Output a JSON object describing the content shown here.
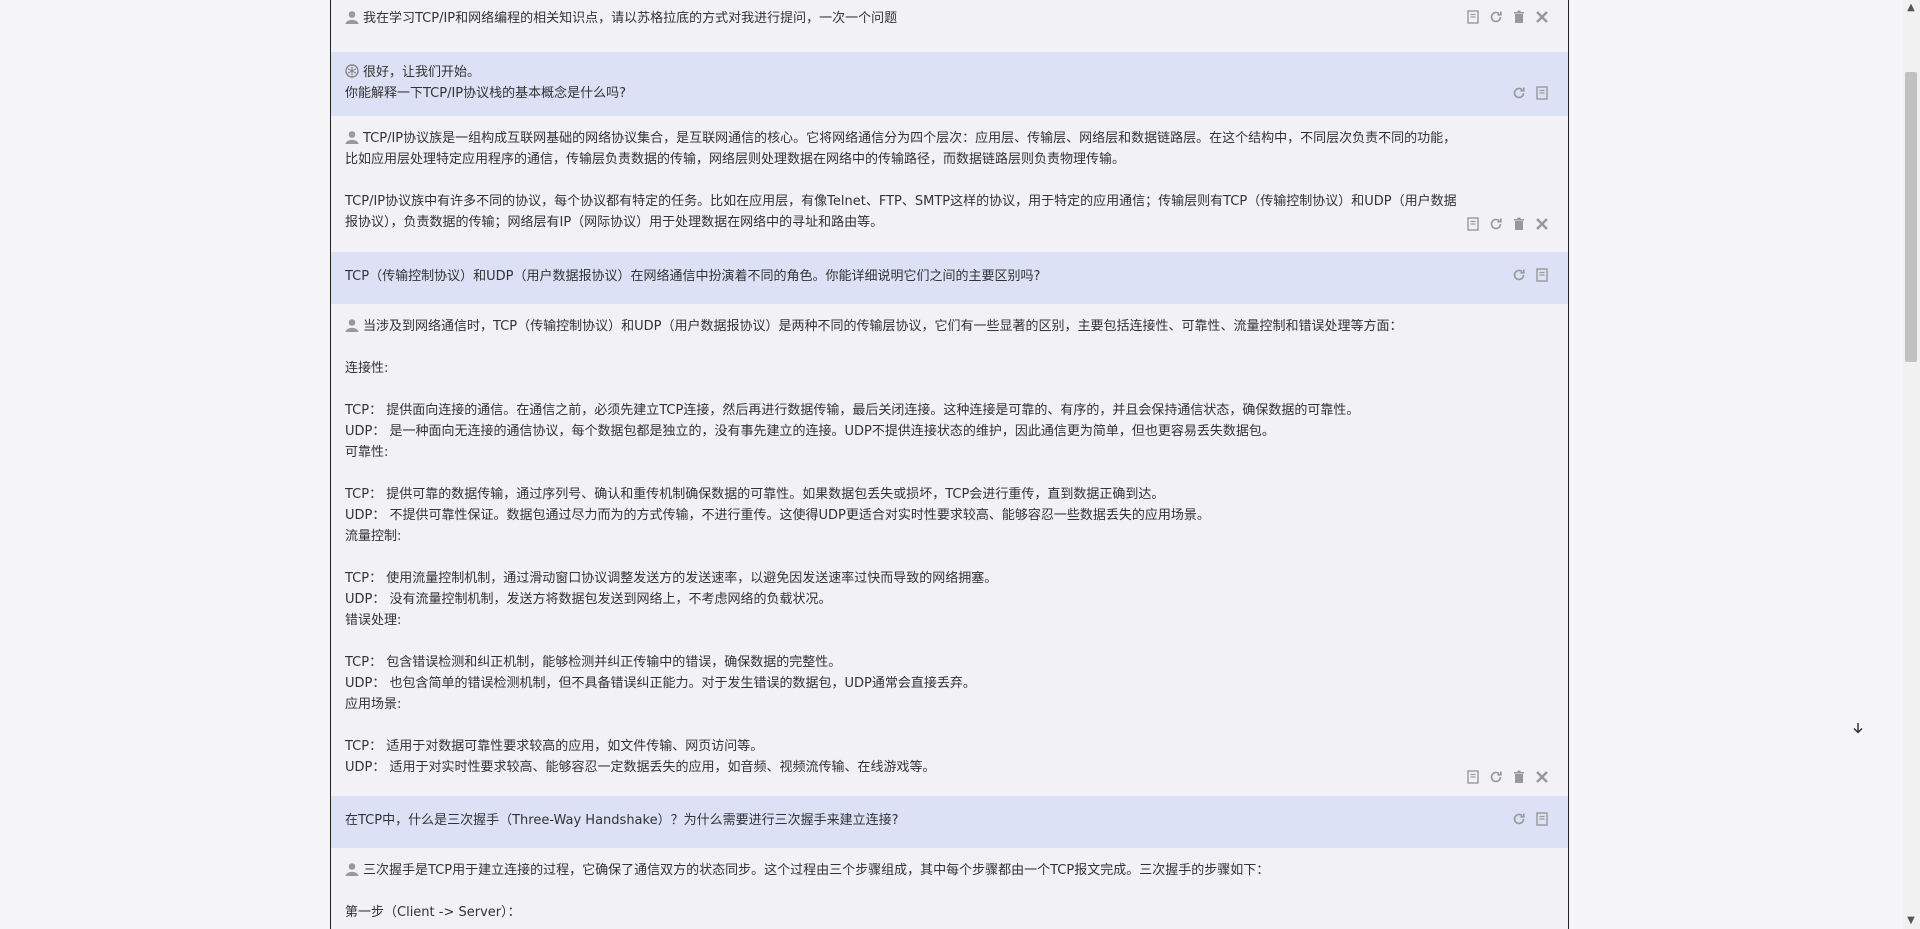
{
  "messages": [
    {
      "role": "user",
      "lines": [
        "我在学习TCP/IP和网络编程的相关知识点，请以苏格拉底的方式对我进行提问，一次一个问题"
      ]
    },
    {
      "role": "bot",
      "lines": [
        "很好，让我们开始。",
        "你能解释一下TCP/IP协议栈的基本概念是什么吗?"
      ]
    },
    {
      "role": "user",
      "lines": [
        "TCP/IP协议族是一组构成互联网基础的网络协议集合，是互联网通信的核心。它将网络通信分为四个层次：应用层、传输层、网络层和数据链路层。在这个结构中，不同层次负责不同的功能，",
        "比如应用层处理特定应用程序的通信，传输层负责数据的传输，网络层则处理数据在网络中的传输路径，而数据链路层则负责物理传输。",
        "",
        "TCP/IP协议族中有许多不同的协议，每个协议都有特定的任务。比如在应用层，有像Telnet、FTP、SMTP这样的协议，用于特定的应用通信；传输层则有TCP（传输控制协议）和UDP（用户数据",
        "报协议），负责数据的传输；网络层有IP（网际协议）用于处理数据在网络中的寻址和路由等。"
      ]
    },
    {
      "role": "bot",
      "lines": [
        "TCP（传输控制协议）和UDP（用户数据报协议）在网络通信中扮演着不同的角色。你能详细说明它们之间的主要区别吗?"
      ]
    },
    {
      "role": "user",
      "lines": [
        "当涉及到网络通信时，TCP（传输控制协议）和UDP（用户数据报协议）是两种不同的传输层协议，它们有一些显著的区别，主要包括连接性、可靠性、流量控制和错误处理等方面：",
        "",
        "连接性:",
        "",
        "TCP： 提供面向连接的通信。在通信之前，必须先建立TCP连接，然后再进行数据传输，最后关闭连接。这种连接是可靠的、有序的，并且会保持通信状态，确保数据的可靠性。",
        "UDP： 是一种面向无连接的通信协议，每个数据包都是独立的，没有事先建立的连接。UDP不提供连接状态的维护，因此通信更为简单，但也更容易丢失数据包。",
        "可靠性:",
        "",
        "TCP： 提供可靠的数据传输，通过序列号、确认和重传机制确保数据的可靠性。如果数据包丢失或损坏，TCP会进行重传，直到数据正确到达。",
        "UDP： 不提供可靠性保证。数据包通过尽力而为的方式传输，不进行重传。这使得UDP更适合对实时性要求较高、能够容忍一些数据丢失的应用场景。",
        "流量控制:",
        "",
        "TCP： 使用流量控制机制，通过滑动窗口协议调整发送方的发送速率，以避免因发送速率过快而导致的网络拥塞。",
        "UDP： 没有流量控制机制，发送方将数据包发送到网络上，不考虑网络的负载状况。",
        "错误处理:",
        "",
        "TCP： 包含错误检测和纠正机制，能够检测并纠正传输中的错误，确保数据的完整性。",
        "UDP： 也包含简单的错误检测机制，但不具备错误纠正能力。对于发生错误的数据包，UDP通常会直接丢弃。",
        "应用场景:",
        "",
        "TCP： 适用于对数据可靠性要求较高的应用，如文件传输、网页访问等。",
        "UDP： 适用于对实时性要求较高、能够容忍一定数据丢失的应用，如音频、视频流传输、在线游戏等。"
      ]
    },
    {
      "role": "bot",
      "lines": [
        "在TCP中，什么是三次握手（Three-Way Handshake）？为什么需要进行三次握手来建立连接?"
      ]
    },
    {
      "role": "user",
      "lines": [
        "三次握手是TCP用于建立连接的过程，它确保了通信双方的状态同步。这个过程由三个步骤组成，其中每个步骤都由一个TCP报文完成。三次握手的步骤如下：",
        "",
        "第一步（Client -> Server）："
      ]
    }
  ]
}
